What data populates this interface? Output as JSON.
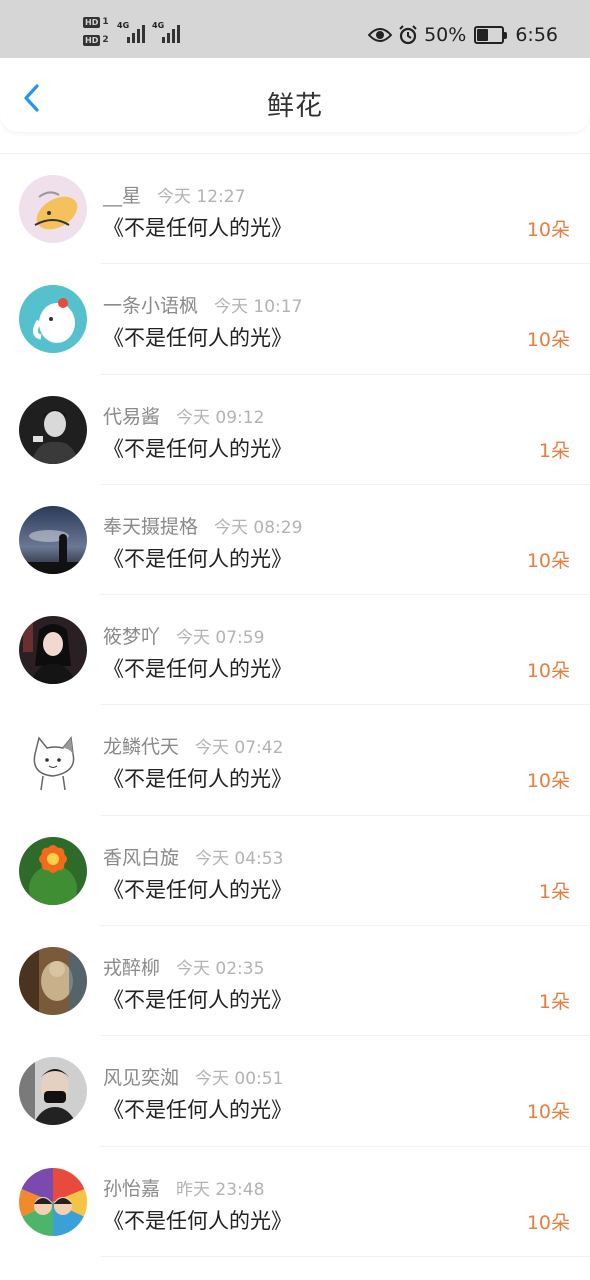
{
  "status_bar": {
    "sims": [
      "1",
      "2"
    ],
    "network": [
      "4G",
      "4G"
    ],
    "battery_percent": "50%",
    "battery_level": 0.5,
    "time": "6:56",
    "icons": [
      "eye-icon",
      "alarm-icon",
      "battery-icon"
    ]
  },
  "header": {
    "title": "鲜花",
    "back_icon": "chevron-left-icon",
    "accent_color": "#2196f3"
  },
  "list": [
    {
      "name": "__星",
      "time": "今天 12:27",
      "work": "《不是任何人的光》",
      "count": "10朵"
    },
    {
      "name": "一条小语枫",
      "time": "今天 10:17",
      "work": "《不是任何人的光》",
      "count": "10朵"
    },
    {
      "name": "代易酱",
      "time": "今天 09:12",
      "work": "《不是任何人的光》",
      "count": "1朵"
    },
    {
      "name": "奉天摄提格",
      "time": "今天 08:29",
      "work": "《不是任何人的光》",
      "count": "10朵"
    },
    {
      "name": "筱梦吖",
      "time": "今天 07:59",
      "work": "《不是任何人的光》",
      "count": "10朵"
    },
    {
      "name": "龙鳞代天",
      "time": "今天 07:42",
      "work": "《不是任何人的光》",
      "count": "10朵"
    },
    {
      "name": "香风白旋",
      "time": "今天 04:53",
      "work": "《不是任何人的光》",
      "count": "1朵"
    },
    {
      "name": "戎醉柳",
      "time": "今天 02:35",
      "work": "《不是任何人的光》",
      "count": "1朵"
    },
    {
      "name": "风见奕洳",
      "time": "今天 00:51",
      "work": "《不是任何人的光》",
      "count": "10朵"
    },
    {
      "name": "孙怡嘉",
      "time": "昨天 23:48",
      "work": "《不是任何人的光》",
      "count": "10朵"
    }
  ],
  "colors": {
    "count": "#e87e3e",
    "name": "#8a8a8a",
    "time": "#b3b3b3",
    "work": "#222222",
    "status_bar_bg": "#d6d6d6"
  }
}
